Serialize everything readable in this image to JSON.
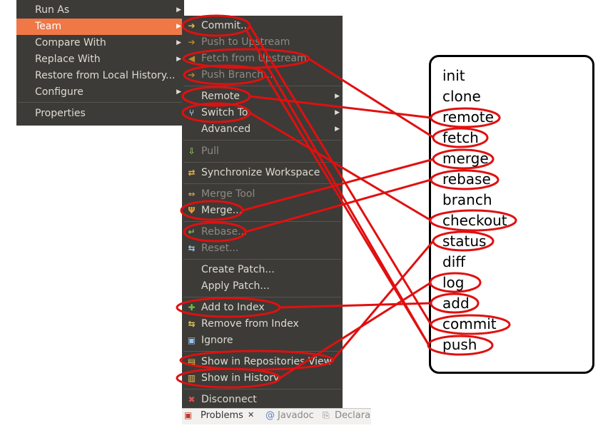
{
  "left_menu": {
    "items": [
      {
        "label": "Run As",
        "accel": "R",
        "rest": "un As",
        "submenu": true
      },
      {
        "label": "Team",
        "submenu": true,
        "active": true
      },
      {
        "label": "Compare With",
        "submenu": true
      },
      {
        "label": "Replace With",
        "submenu": true
      },
      {
        "label": "Restore from Local History..."
      },
      {
        "label": "Configure",
        "submenu": true
      },
      {
        "label": "Properties",
        "accel": "P",
        "rest": "roperties"
      }
    ]
  },
  "team_menu": {
    "commit": "Commit...",
    "push_upstream": "Push to Upstream",
    "fetch_upstream": "Fetch from Upstream",
    "push_branch": "Push Branch...",
    "remote": "Remote",
    "switch_to": "Switch To",
    "advanced": "Advanced",
    "pull": "Pull",
    "synchronize": "Synchronize Workspace",
    "merge_tool": "Merge Tool",
    "merge": "Merge...",
    "rebase": "Rebase...",
    "reset": "Reset...",
    "create_patch": "Create Patch...",
    "apply_patch": "Apply Patch...",
    "add_index": "Add to Index",
    "remove_index": "Remove from Index",
    "ignore": "Ignore",
    "show_repos": "Show in Repositories View",
    "show_history": "Show in History",
    "disconnect": "Disconnect"
  },
  "tabs": {
    "problems": "Problems",
    "javadoc": "Javadoc",
    "declaration": "Declara"
  },
  "git_commands": [
    "init",
    "clone",
    "remote",
    "fetch",
    "merge",
    "rebase",
    "branch",
    "checkout",
    "status",
    "diff",
    "log",
    "add",
    "commit",
    "push"
  ],
  "colors": {
    "menu_bg": "#3c3b37",
    "highlight": "#f07746",
    "annotation": "#e01010"
  }
}
